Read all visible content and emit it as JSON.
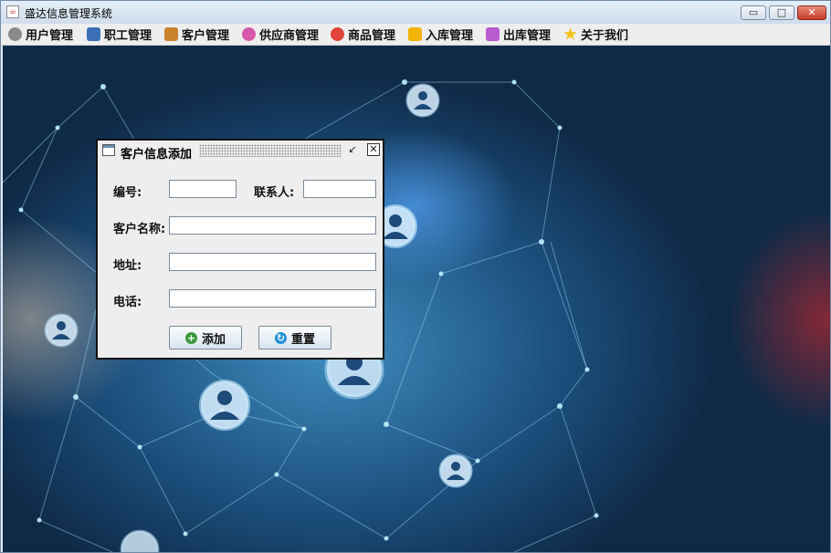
{
  "window": {
    "title": "盛达信息管理系统",
    "min_glyph": "▭",
    "max_glyph": "□",
    "close_glyph": "✕"
  },
  "menu": {
    "items": [
      {
        "label": "用户管理",
        "icon": "gear-icon",
        "color": "#8a8a8a"
      },
      {
        "label": "职工管理",
        "icon": "staff-icon",
        "color": "#3b6fb6"
      },
      {
        "label": "客户管理",
        "icon": "customer-icon",
        "color": "#c9822e"
      },
      {
        "label": "供应商管理",
        "icon": "supplier-icon",
        "color": "#d65aa8"
      },
      {
        "label": "商品管理",
        "icon": "goods-icon",
        "color": "#e0443a"
      },
      {
        "label": "入库管理",
        "icon": "inbound-icon",
        "color": "#f0b400"
      },
      {
        "label": "出库管理",
        "icon": "outbound-icon",
        "color": "#b85ad0"
      },
      {
        "label": "关于我们",
        "icon": "star-icon",
        "color": "#f3c21b"
      }
    ]
  },
  "dialog": {
    "title": "客户信息添加",
    "restore_glyph": "↙",
    "close_glyph": "✕",
    "labels": {
      "id": "编号:",
      "contact": "联系人:",
      "name": "客户名称:",
      "address": "地址:",
      "phone": "电话:"
    },
    "values": {
      "id": "",
      "contact": "",
      "name": "",
      "address": "",
      "phone": ""
    },
    "buttons": {
      "add": "添加",
      "add_glyph": "+",
      "reset": "重置",
      "reset_glyph": "↻"
    }
  },
  "colors": {
    "accent": "#4fb3e0",
    "add_icon": "#3a9a3a",
    "reset_icon": "#1f8fd6"
  }
}
